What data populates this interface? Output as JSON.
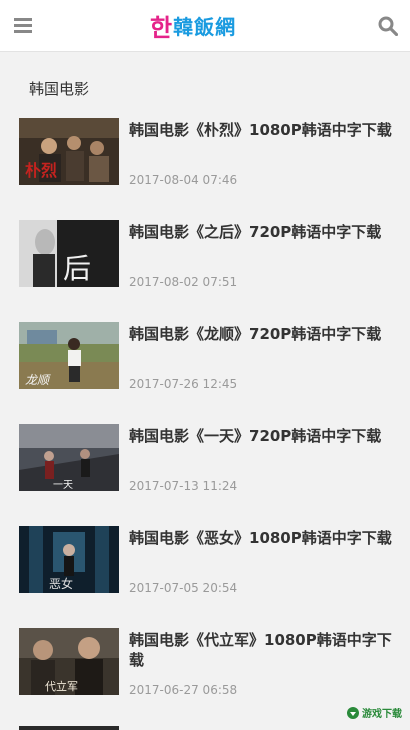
{
  "header": {
    "logo_mark": "한",
    "logo_text": "韓飯網",
    "menu_icon": "menu-icon",
    "search_icon": "search-icon"
  },
  "section": {
    "title": "韩国电影"
  },
  "articles": [
    {
      "title": "韩国电影《朴烈》1080P韩语中字下载",
      "date": "2017-08-04 07:46"
    },
    {
      "title": "韩国电影《之后》720P韩语中字下载",
      "date": "2017-08-02 07:51"
    },
    {
      "title": "韩国电影《龙顺》720P韩语中字下载",
      "date": "2017-07-26 12:45"
    },
    {
      "title": "韩国电影《一天》720P韩语中字下载",
      "date": "2017-07-13 11:24"
    },
    {
      "title": "韩国电影《恶女》1080P韩语中字下载",
      "date": "2017-07-05 20:54"
    },
    {
      "title": "韩国电影《代立军》1080P韩语中字下载",
      "date": "2017-06-27 06:58"
    }
  ],
  "watermark": {
    "text": "游戏下载"
  },
  "colors": {
    "logo_pink": "#e5238a",
    "logo_blue": "#1a9be0",
    "date_gray": "#9a9a9a",
    "background": "#f2f2f2"
  }
}
